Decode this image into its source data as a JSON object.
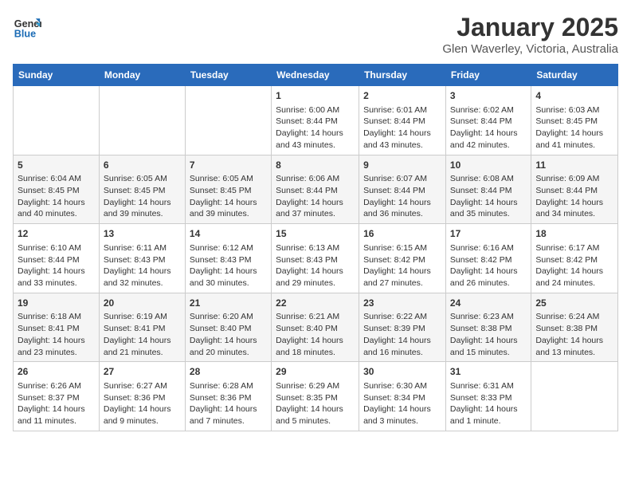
{
  "header": {
    "logo_line1": "General",
    "logo_line2": "Blue",
    "month": "January 2025",
    "location": "Glen Waverley, Victoria, Australia"
  },
  "days_of_week": [
    "Sunday",
    "Monday",
    "Tuesday",
    "Wednesday",
    "Thursday",
    "Friday",
    "Saturday"
  ],
  "weeks": [
    [
      {
        "day": "",
        "content": ""
      },
      {
        "day": "",
        "content": ""
      },
      {
        "day": "",
        "content": ""
      },
      {
        "day": "1",
        "content": "Sunrise: 6:00 AM\nSunset: 8:44 PM\nDaylight: 14 hours\nand 43 minutes."
      },
      {
        "day": "2",
        "content": "Sunrise: 6:01 AM\nSunset: 8:44 PM\nDaylight: 14 hours\nand 43 minutes."
      },
      {
        "day": "3",
        "content": "Sunrise: 6:02 AM\nSunset: 8:44 PM\nDaylight: 14 hours\nand 42 minutes."
      },
      {
        "day": "4",
        "content": "Sunrise: 6:03 AM\nSunset: 8:45 PM\nDaylight: 14 hours\nand 41 minutes."
      }
    ],
    [
      {
        "day": "5",
        "content": "Sunrise: 6:04 AM\nSunset: 8:45 PM\nDaylight: 14 hours\nand 40 minutes."
      },
      {
        "day": "6",
        "content": "Sunrise: 6:05 AM\nSunset: 8:45 PM\nDaylight: 14 hours\nand 39 minutes."
      },
      {
        "day": "7",
        "content": "Sunrise: 6:05 AM\nSunset: 8:45 PM\nDaylight: 14 hours\nand 39 minutes."
      },
      {
        "day": "8",
        "content": "Sunrise: 6:06 AM\nSunset: 8:44 PM\nDaylight: 14 hours\nand 37 minutes."
      },
      {
        "day": "9",
        "content": "Sunrise: 6:07 AM\nSunset: 8:44 PM\nDaylight: 14 hours\nand 36 minutes."
      },
      {
        "day": "10",
        "content": "Sunrise: 6:08 AM\nSunset: 8:44 PM\nDaylight: 14 hours\nand 35 minutes."
      },
      {
        "day": "11",
        "content": "Sunrise: 6:09 AM\nSunset: 8:44 PM\nDaylight: 14 hours\nand 34 minutes."
      }
    ],
    [
      {
        "day": "12",
        "content": "Sunrise: 6:10 AM\nSunset: 8:44 PM\nDaylight: 14 hours\nand 33 minutes."
      },
      {
        "day": "13",
        "content": "Sunrise: 6:11 AM\nSunset: 8:43 PM\nDaylight: 14 hours\nand 32 minutes."
      },
      {
        "day": "14",
        "content": "Sunrise: 6:12 AM\nSunset: 8:43 PM\nDaylight: 14 hours\nand 30 minutes."
      },
      {
        "day": "15",
        "content": "Sunrise: 6:13 AM\nSunset: 8:43 PM\nDaylight: 14 hours\nand 29 minutes."
      },
      {
        "day": "16",
        "content": "Sunrise: 6:15 AM\nSunset: 8:42 PM\nDaylight: 14 hours\nand 27 minutes."
      },
      {
        "day": "17",
        "content": "Sunrise: 6:16 AM\nSunset: 8:42 PM\nDaylight: 14 hours\nand 26 minutes."
      },
      {
        "day": "18",
        "content": "Sunrise: 6:17 AM\nSunset: 8:42 PM\nDaylight: 14 hours\nand 24 minutes."
      }
    ],
    [
      {
        "day": "19",
        "content": "Sunrise: 6:18 AM\nSunset: 8:41 PM\nDaylight: 14 hours\nand 23 minutes."
      },
      {
        "day": "20",
        "content": "Sunrise: 6:19 AM\nSunset: 8:41 PM\nDaylight: 14 hours\nand 21 minutes."
      },
      {
        "day": "21",
        "content": "Sunrise: 6:20 AM\nSunset: 8:40 PM\nDaylight: 14 hours\nand 20 minutes."
      },
      {
        "day": "22",
        "content": "Sunrise: 6:21 AM\nSunset: 8:40 PM\nDaylight: 14 hours\nand 18 minutes."
      },
      {
        "day": "23",
        "content": "Sunrise: 6:22 AM\nSunset: 8:39 PM\nDaylight: 14 hours\nand 16 minutes."
      },
      {
        "day": "24",
        "content": "Sunrise: 6:23 AM\nSunset: 8:38 PM\nDaylight: 14 hours\nand 15 minutes."
      },
      {
        "day": "25",
        "content": "Sunrise: 6:24 AM\nSunset: 8:38 PM\nDaylight: 14 hours\nand 13 minutes."
      }
    ],
    [
      {
        "day": "26",
        "content": "Sunrise: 6:26 AM\nSunset: 8:37 PM\nDaylight: 14 hours\nand 11 minutes."
      },
      {
        "day": "27",
        "content": "Sunrise: 6:27 AM\nSunset: 8:36 PM\nDaylight: 14 hours\nand 9 minutes."
      },
      {
        "day": "28",
        "content": "Sunrise: 6:28 AM\nSunset: 8:36 PM\nDaylight: 14 hours\nand 7 minutes."
      },
      {
        "day": "29",
        "content": "Sunrise: 6:29 AM\nSunset: 8:35 PM\nDaylight: 14 hours\nand 5 minutes."
      },
      {
        "day": "30",
        "content": "Sunrise: 6:30 AM\nSunset: 8:34 PM\nDaylight: 14 hours\nand 3 minutes."
      },
      {
        "day": "31",
        "content": "Sunrise: 6:31 AM\nSunset: 8:33 PM\nDaylight: 14 hours\nand 1 minute."
      },
      {
        "day": "",
        "content": ""
      }
    ]
  ]
}
